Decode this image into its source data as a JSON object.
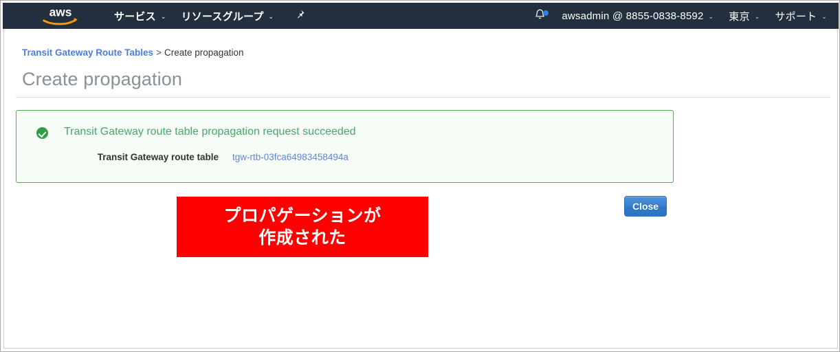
{
  "navbar": {
    "logo_alt": "aws",
    "services_label": "サービス",
    "resource_groups_label": "リソースグループ",
    "pin_icon": "pushpin-icon",
    "bell_icon": "notification-bell-icon",
    "account_label": "awsadmin @ 8855-0838-8592",
    "region_label": "東京",
    "support_label": "サポート",
    "caret": "⌄",
    "background_color": "#232f3e",
    "logo_accent_color": "#ff9900",
    "notification_dot_color": "#2d7fe0"
  },
  "breadcrumb": {
    "parent_label": "Transit Gateway Route Tables",
    "separator": ">",
    "current_label": "Create propagation",
    "link_color": "#4a7ee0"
  },
  "page": {
    "title": "Create propagation"
  },
  "alert": {
    "status": "success",
    "icon": "check-circle-icon",
    "title": "Transit Gateway route table propagation request succeeded",
    "border_color": "#4caf50",
    "background_color": "#f6fcf6",
    "title_color": "#4aa66a",
    "detail_label": "Transit Gateway route table",
    "detail_value": "tgw-rtb-03fca64983458494a",
    "detail_value_color": "#5f85d8"
  },
  "annotation": {
    "line1": "プロパゲーションが",
    "line2": "作成された",
    "background_color": "#fe0000",
    "text_color": "#ffffff"
  },
  "actions": {
    "close_label": "Close",
    "close_color": "#3a82cf"
  }
}
